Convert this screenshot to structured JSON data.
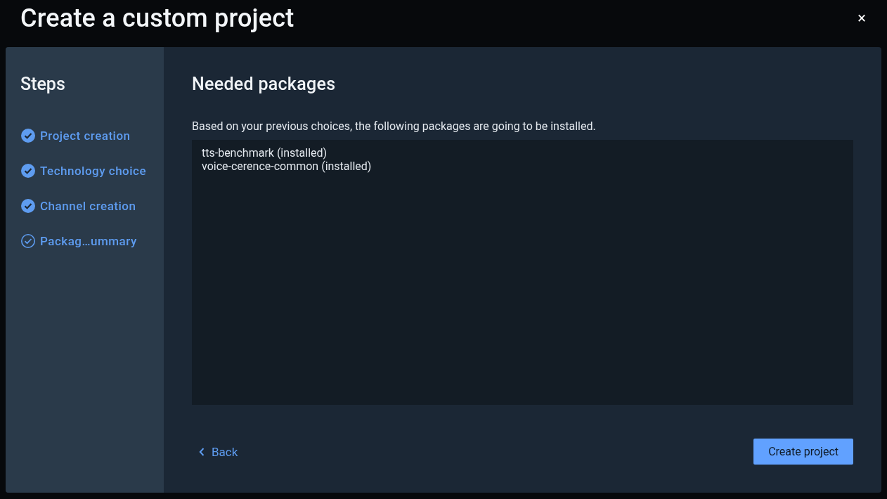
{
  "window": {
    "title": "Create a custom project",
    "close": "×"
  },
  "sidebar": {
    "title": "Steps",
    "steps": [
      {
        "label": "Project creation",
        "completed": true
      },
      {
        "label": "Technology choice",
        "completed": true
      },
      {
        "label": "Channel creation",
        "completed": true
      },
      {
        "label": "Packag…ummary",
        "completed": false
      }
    ]
  },
  "content": {
    "heading": "Needed packages",
    "description": "Based on your previous choices, the following packages are going to be installed.",
    "packages": [
      "tts-benchmark (installed)",
      "voice-cerence-common (installed)"
    ]
  },
  "footer": {
    "back": "Back",
    "create": "Create project"
  }
}
